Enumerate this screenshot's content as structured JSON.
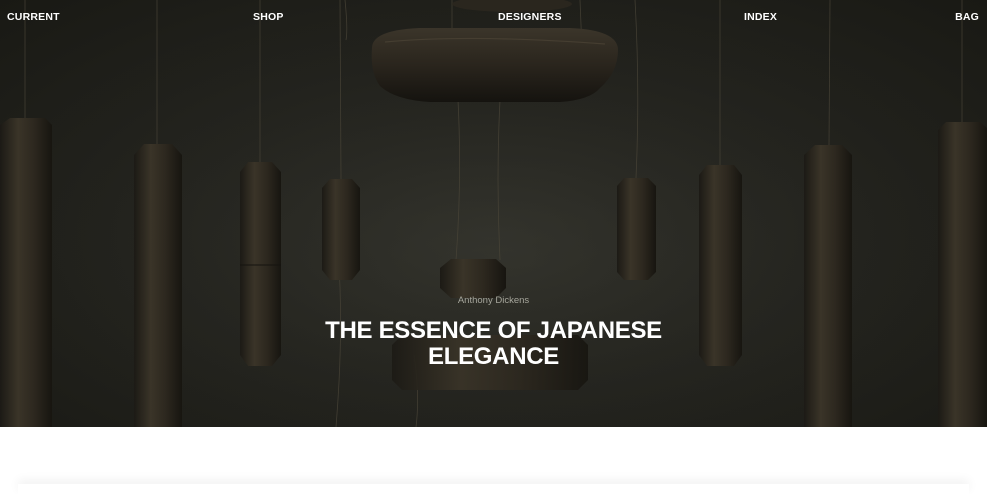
{
  "nav": {
    "current": "CURRENT",
    "shop": "SHOP",
    "designers": "DESIGNERS",
    "index": "INDEX",
    "bag": "BAG"
  },
  "hero": {
    "designer": "Anthony Dickens",
    "headline": "THE ESSENCE OF JAPANESE ELEGANCE",
    "image_subject": "pendant-lamps"
  },
  "colors": {
    "hero_background": "#24241f",
    "nav_text": "#ffffff",
    "headline_text": "#ffffff",
    "designer_text": "#a6a69c",
    "page_background": "#ffffff"
  }
}
